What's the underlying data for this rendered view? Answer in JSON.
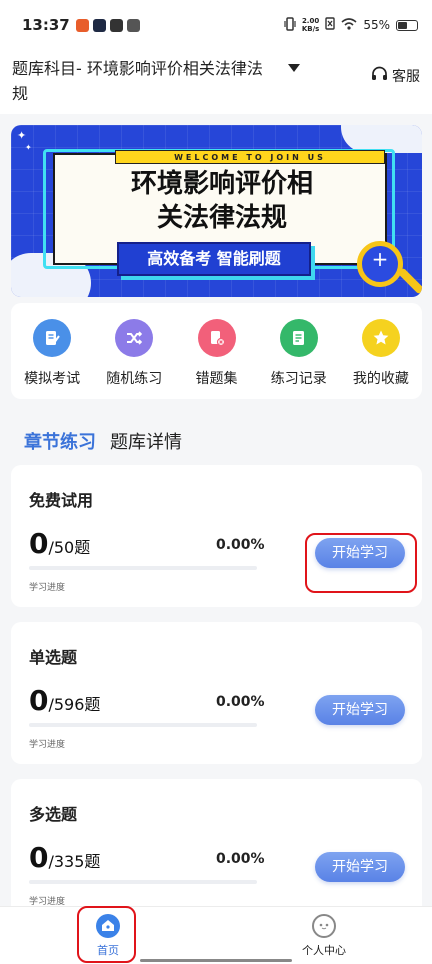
{
  "status_bar": {
    "time": "13:37",
    "net_speed_value": "2.00",
    "net_speed_unit": "KB/s",
    "battery_percent_text": "55%",
    "battery_level": 0.55
  },
  "header": {
    "title": "题库科目- 环境影响评价相关法律法规",
    "service_label": "客服"
  },
  "banner": {
    "welcome": "WELCOME TO JOIN US",
    "headline_line1": "环境影响评价相",
    "headline_line2": "关法律法规",
    "tagline": "高效备考 智能刷题"
  },
  "quick_actions": [
    {
      "label": "模拟考试",
      "icon": "exam-icon",
      "color": "#4a90e8"
    },
    {
      "label": "随机练习",
      "icon": "shuffle-icon",
      "color": "#8c7be8"
    },
    {
      "label": "错题集",
      "icon": "wrong-questions-icon",
      "color": "#f2607a"
    },
    {
      "label": "练习记录",
      "icon": "record-icon",
      "color": "#34b86a"
    },
    {
      "label": "我的收藏",
      "icon": "star-icon",
      "color": "#f5d21f"
    }
  ],
  "tabs": {
    "chapter": "章节练习",
    "details": "题库详情"
  },
  "question_sets": [
    {
      "title": "免费试用",
      "done": "0",
      "total": "/50题",
      "percent": "0.00%",
      "progress": 0.0,
      "progress_label": "学习进度",
      "button": "开始学习"
    },
    {
      "title": "单选题",
      "done": "0",
      "total": "/596题",
      "percent": "0.00%",
      "progress": 0.0,
      "progress_label": "学习进度",
      "button": "开始学习"
    },
    {
      "title": "多选题",
      "done": "0",
      "total": "/335题",
      "percent": "0.00%",
      "progress": 0.0,
      "progress_label": "学习进度",
      "button": "开始学习"
    }
  ],
  "bottom_nav": {
    "home": "首页",
    "profile": "个人中心"
  },
  "colors": {
    "accent": "#3b73d9",
    "highlight": "#e0141a",
    "banner_blue": "#2646d8"
  }
}
